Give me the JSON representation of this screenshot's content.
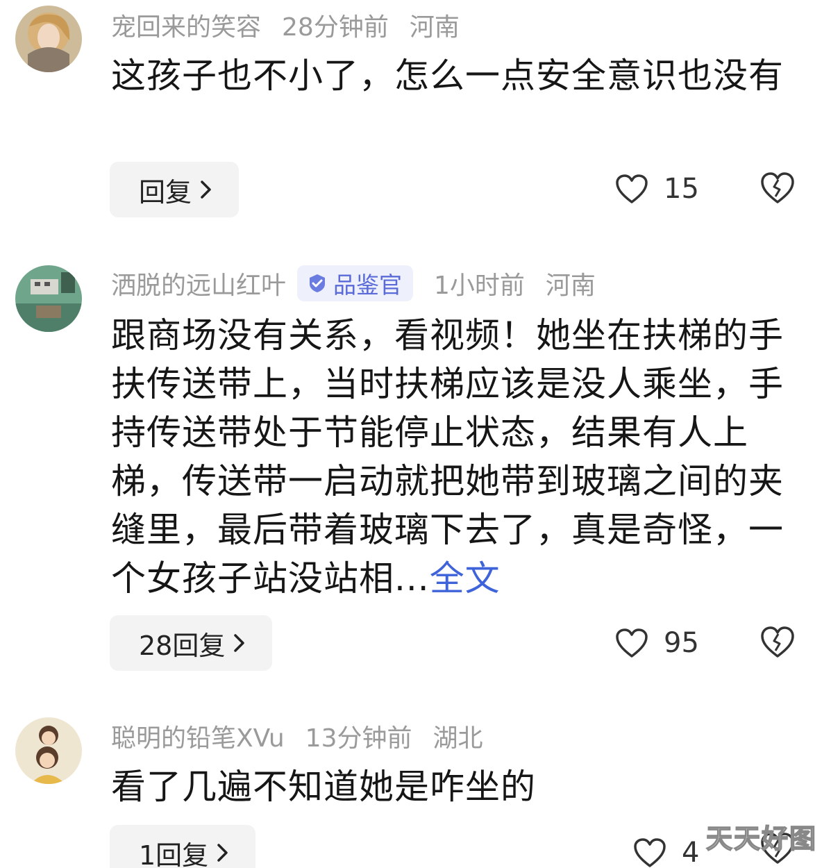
{
  "comments": [
    {
      "username": "宠回来的笑容",
      "time": "28分钟前",
      "location": "河南",
      "text": "这孩子也不小了，怎么一点安全意识也没有",
      "reply_label": "回复",
      "likes": "15",
      "avatar_icon": "avatar-anime-girl-icon"
    },
    {
      "username": "洒脱的远山红叶",
      "badge": "品鉴官",
      "time": "1小时前",
      "location": "河南",
      "text": "跟商场没有关系，看视频！她坐在扶梯的手扶传送带上，当时扶梯应该是没人乘坐，手持传送带处于节能停止状态，结果有人上梯，传送带一启动就把她带到玻璃之间的夹缝里，最后带着玻璃下去了，真是奇怪，一个女孩子站没站相...",
      "more_label": "全文",
      "reply_label": "28回复",
      "likes": "95",
      "avatar_icon": "avatar-aerial-landscape-icon"
    },
    {
      "username": "聪明的铅笔XVu",
      "time": "13分钟前",
      "location": "湖北",
      "text": "看了几遍不知道她是咋坐的",
      "reply_label": "1回复",
      "likes": "4",
      "avatar_icon": "avatar-cartoon-girls-icon"
    }
  ],
  "watermark": "天天好图",
  "colors": {
    "meta_gray": "#9a9a9a",
    "link_blue": "#3f63d9",
    "badge_bg": "#eef0fb",
    "reply_bg": "#f3f3f3"
  }
}
